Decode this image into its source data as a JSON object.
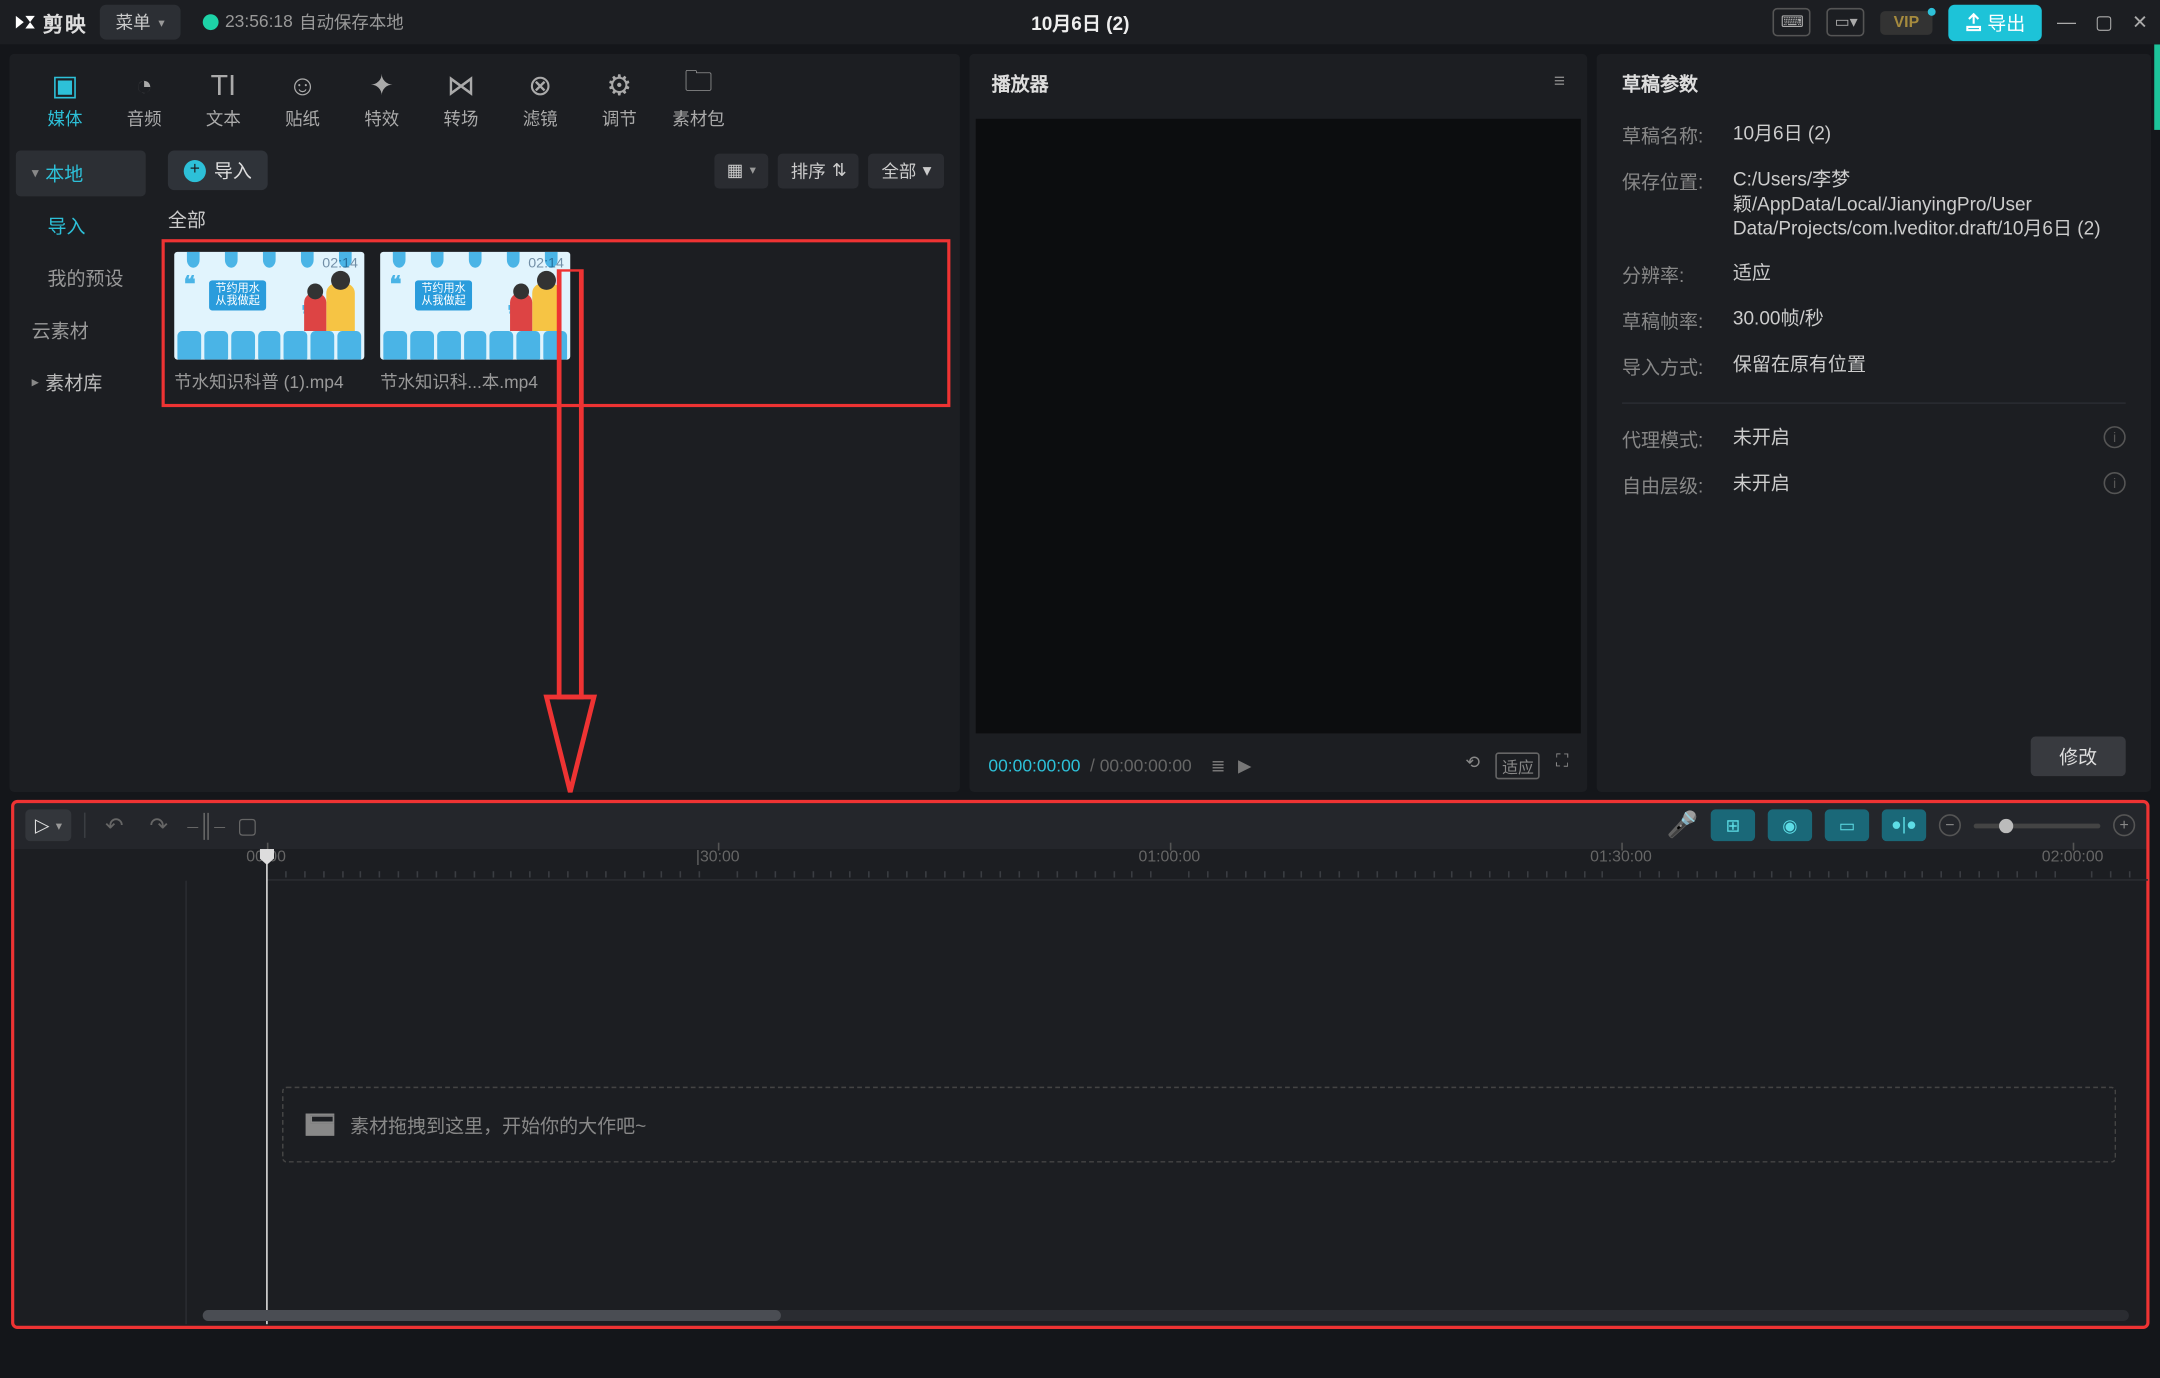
{
  "titlebar": {
    "logo": "剪映",
    "menu": "菜单",
    "autosave_time": "23:56:18",
    "autosave_text": "自动保存本地",
    "doc_title": "10月6日 (2)",
    "vip": "VIP",
    "export": "导出"
  },
  "top_tabs": {
    "media": "媒体",
    "audio": "音频",
    "text": "文本",
    "sticker": "贴纸",
    "effect": "特效",
    "transition": "转场",
    "filter": "滤镜",
    "adjust": "调节",
    "pack": "素材包"
  },
  "side": {
    "local": "本地",
    "import": "导入",
    "preset": "我的预设",
    "cloud": "云素材",
    "library": "素材库"
  },
  "media": {
    "import_btn": "导入",
    "sort": "排序",
    "all_chip": "全部",
    "all_label": "全部",
    "items": [
      {
        "name": "节水知识科普 (1).mp4",
        "dur": "02:14",
        "banner1": "节约用水",
        "banner2": "从我做起"
      },
      {
        "name": "节水知识科...本.mp4",
        "dur": "02:14",
        "banner1": "节约用水",
        "banner2": "从我做起"
      }
    ]
  },
  "player": {
    "title": "播放器",
    "current": "00:00:00:00",
    "total": "00:00:00:00",
    "fit": "适应"
  },
  "props": {
    "title": "草稿参数",
    "rows": {
      "name_l": "草稿名称:",
      "name_v": "10月6日 (2)",
      "path_l": "保存位置:",
      "path_v": "C:/Users/李梦颖/AppData/Local/JianyingPro/User Data/Projects/com.lveditor.draft/10月6日 (2)",
      "res_l": "分辨率:",
      "res_v": "适应",
      "fps_l": "草稿帧率:",
      "fps_v": "30.00帧/秒",
      "imp_l": "导入方式:",
      "imp_v": "保留在原有位置",
      "proxy_l": "代理模式:",
      "proxy_v": "未开启",
      "layer_l": "自由层级:",
      "layer_v": "未开启"
    },
    "modify": "修改"
  },
  "timeline": {
    "drop_text": "素材拖拽到这里，开始你的大作吧~",
    "ticks": [
      "00:00",
      "|30:00",
      "01:00:00",
      "01:30:00",
      "02:00:00"
    ]
  }
}
